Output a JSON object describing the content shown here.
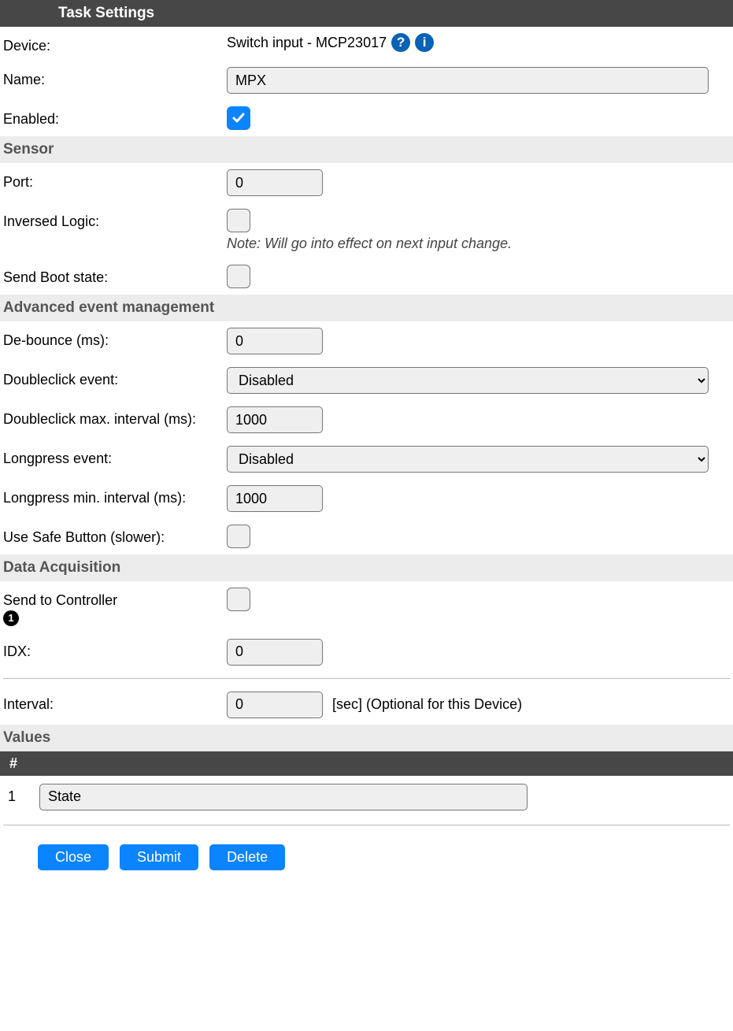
{
  "header": "Task Settings",
  "device": {
    "label": "Device:",
    "value": "Switch input - MCP23017"
  },
  "name": {
    "label": "Name:",
    "value": "MPX"
  },
  "enabled": {
    "label": "Enabled:",
    "checked": true
  },
  "sensor": {
    "header": "Sensor",
    "port": {
      "label": "Port:",
      "value": "0"
    },
    "inversed": {
      "label": "Inversed Logic:",
      "checked": false,
      "note": "Note: Will go into effect on next input change."
    },
    "sendboot": {
      "label": "Send Boot state:",
      "checked": false
    }
  },
  "advanced": {
    "header": "Advanced event management",
    "debounce": {
      "label": "De-bounce (ms):",
      "value": "0"
    },
    "dblclick_event": {
      "label": "Doubleclick event:",
      "value": "Disabled"
    },
    "dblclick_max": {
      "label": "Doubleclick max. interval (ms):",
      "value": "1000"
    },
    "longpress_event": {
      "label": "Longpress event:",
      "value": "Disabled"
    },
    "longpress_min": {
      "label": "Longpress min. interval (ms):",
      "value": "1000"
    },
    "safebutton": {
      "label": "Use Safe Button (slower):",
      "checked": false
    }
  },
  "acquisition": {
    "header": "Data Acquisition",
    "sendctrl": {
      "label": "Send to Controller",
      "badge": "1",
      "checked": false
    },
    "idx": {
      "label": "IDX:",
      "value": "0"
    },
    "interval": {
      "label": "Interval:",
      "value": "0",
      "suffix": "[sec] (Optional for this Device)"
    }
  },
  "values": {
    "header": "Values",
    "col": "#",
    "rows": [
      {
        "num": "1",
        "name": "State"
      }
    ]
  },
  "buttons": {
    "close": "Close",
    "submit": "Submit",
    "delete": "Delete"
  }
}
